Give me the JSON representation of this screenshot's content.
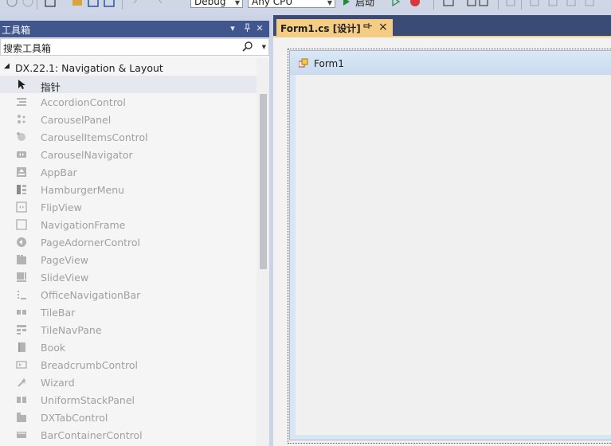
{
  "toolbar": {
    "configuration": "Debug",
    "platform": "Any CPU",
    "start_label": "启动"
  },
  "toolbox": {
    "title": "工具箱",
    "search_placeholder": "搜索工具箱",
    "group": "DX.22.1: Navigation & Layout",
    "items": [
      {
        "label": "指针",
        "icon": "pointer-icon"
      },
      {
        "label": "AccordionControl",
        "icon": "accordion-icon"
      },
      {
        "label": "CarouselPanel",
        "icon": "carousel-panel-icon"
      },
      {
        "label": "CarouselItemsControl",
        "icon": "carousel-items-icon"
      },
      {
        "label": "CarouselNavigator",
        "icon": "carousel-navigator-icon"
      },
      {
        "label": "AppBar",
        "icon": "appbar-icon"
      },
      {
        "label": "HamburgerMenu",
        "icon": "hamburger-menu-icon"
      },
      {
        "label": "FlipView",
        "icon": "flipview-icon"
      },
      {
        "label": "NavigationFrame",
        "icon": "navigation-frame-icon"
      },
      {
        "label": "PageAdornerControl",
        "icon": "page-adorner-icon"
      },
      {
        "label": "PageView",
        "icon": "pageview-icon"
      },
      {
        "label": "SlideView",
        "icon": "slideview-icon"
      },
      {
        "label": "OfficeNavigationBar",
        "icon": "office-navbar-icon"
      },
      {
        "label": "TileBar",
        "icon": "tilebar-icon"
      },
      {
        "label": "TileNavPane",
        "icon": "tilenavpane-icon"
      },
      {
        "label": "Book",
        "icon": "book-icon"
      },
      {
        "label": "BreadcrumbControl",
        "icon": "breadcrumb-icon"
      },
      {
        "label": "Wizard",
        "icon": "wizard-icon"
      },
      {
        "label": "UniformStackPanel",
        "icon": "uniform-stack-icon"
      },
      {
        "label": "DXTabControl",
        "icon": "tabcontrol-icon"
      },
      {
        "label": "BarContainerControl",
        "icon": "bar-container-icon"
      }
    ]
  },
  "document": {
    "tab_label": "Form1.cs [设计]",
    "form_title": "Form1"
  },
  "colors": {
    "header_bg": "#40568d",
    "tab_active": "#f5cc84",
    "doc_bg": "#293955"
  }
}
